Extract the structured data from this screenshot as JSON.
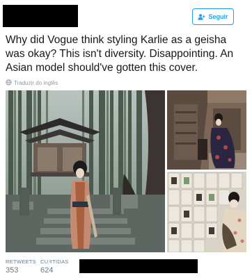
{
  "header": {
    "follow_label": "Seguir"
  },
  "tweet": {
    "text": "Why did Vogue think styling Karlie as a geisha was okay? This isn't diversity. Disappointing. An Asian model should've gotten this cover.",
    "translate_label": "Traduzir do inglês"
  },
  "stats": {
    "retweets_label": "RETWEETS",
    "retweets_value": "353",
    "likes_label": "CURTIDAS",
    "likes_value": "624"
  },
  "colors": {
    "accent": "#1da1f2",
    "muted": "#657786"
  }
}
